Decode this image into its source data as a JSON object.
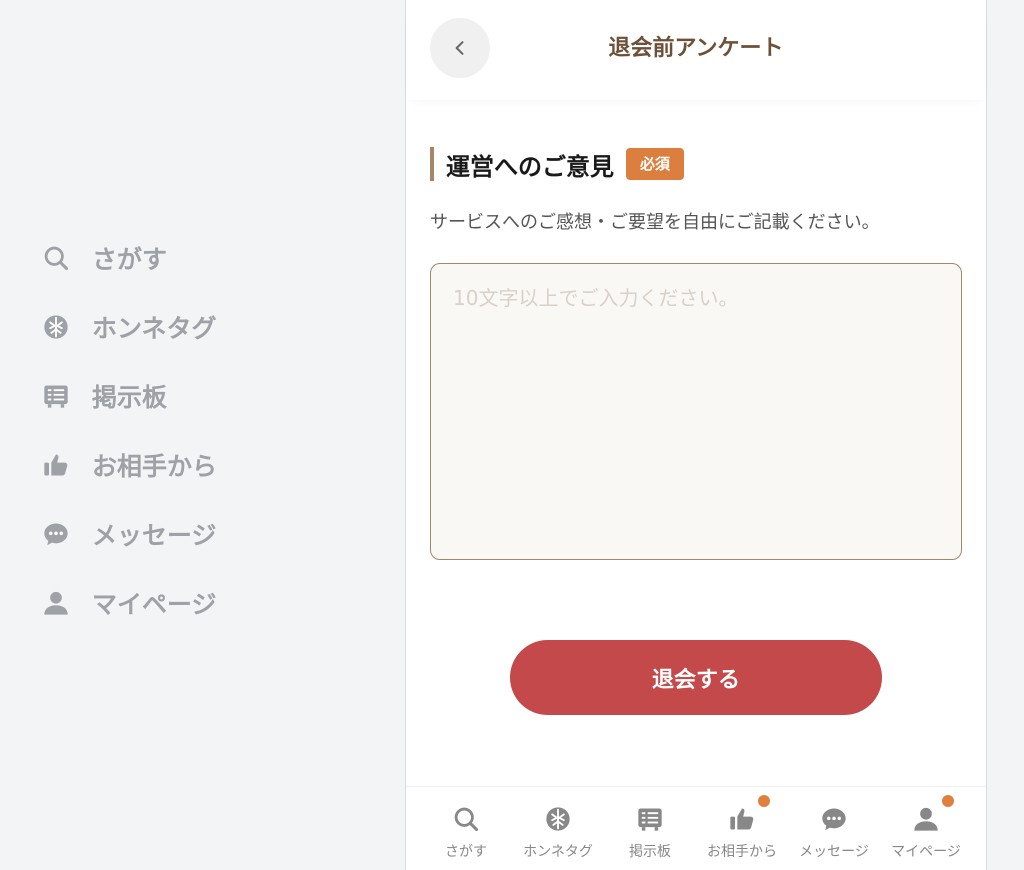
{
  "side_nav": {
    "items": [
      {
        "label": "さがす",
        "icon": "search-icon"
      },
      {
        "label": "ホンネタグ",
        "icon": "tag-icon"
      },
      {
        "label": "掲示板",
        "icon": "board-icon"
      },
      {
        "label": "お相手から",
        "icon": "thumbs-up-icon"
      },
      {
        "label": "メッセージ",
        "icon": "message-icon"
      },
      {
        "label": "マイページ",
        "icon": "user-icon"
      }
    ]
  },
  "header": {
    "title": "退会前アンケート"
  },
  "section": {
    "title": "運営へのご意見",
    "badge": "必須",
    "description": "サービスへのご感想・ご要望を自由にご記載ください。"
  },
  "form": {
    "placeholder": "10文字以上でご入力ください。",
    "value": "",
    "submit_label": "退会する"
  },
  "tabbar": {
    "tabs": [
      {
        "label": "さがす",
        "icon": "search-icon",
        "notification": false
      },
      {
        "label": "ホンネタグ",
        "icon": "tag-icon",
        "notification": false
      },
      {
        "label": "掲示板",
        "icon": "board-icon",
        "notification": false
      },
      {
        "label": "お相手から",
        "icon": "thumbs-up-icon",
        "notification": true
      },
      {
        "label": "メッセージ",
        "icon": "message-icon",
        "notification": false
      },
      {
        "label": "マイページ",
        "icon": "user-icon",
        "notification": true
      }
    ]
  },
  "colors": {
    "accent_brown": "#6e4f37",
    "badge_orange": "#dc7f3e",
    "submit_red": "#c4494b",
    "icon_gray": "#9ea1a6"
  }
}
